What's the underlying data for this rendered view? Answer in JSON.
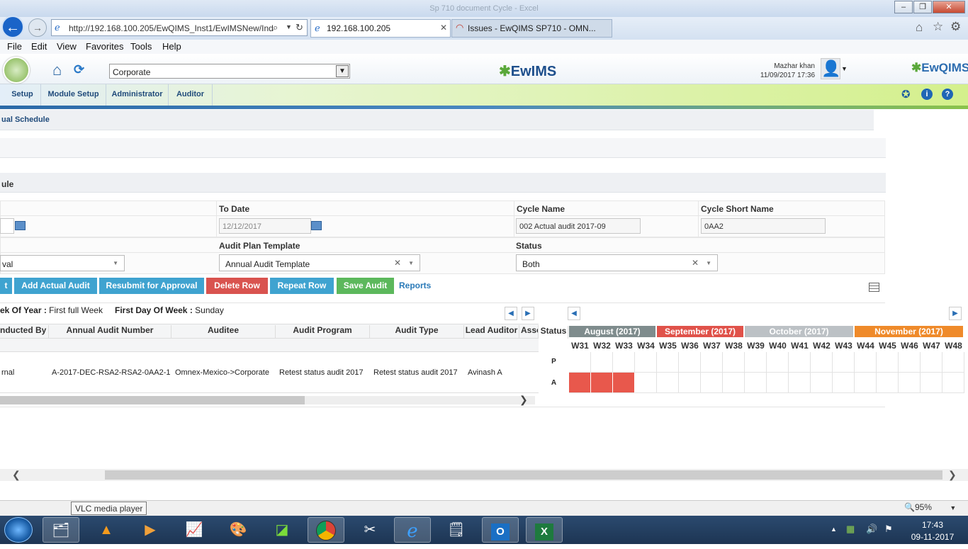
{
  "window": {
    "title": "Sp 710 document Cycle - Excel"
  },
  "browser": {
    "address": "http://192.168.100.205/EwQIMS_Inst1/EwIMSNew/Ind",
    "tabs": [
      {
        "label": "192.168.100.205"
      },
      {
        "label": "Issues - EwQIMS SP710 - OMN..."
      }
    ]
  },
  "menu": [
    "File",
    "Edit",
    "View",
    "Favorites",
    "Tools",
    "Help"
  ],
  "header": {
    "org": "Corporate",
    "logo": "EwIMS",
    "logo_right": "EwQIMS",
    "user_name": "Mazhar khan",
    "user_time": "11/09/2017 17:36"
  },
  "nav": [
    "Setup",
    "Module Setup",
    "Administrator",
    "Auditor"
  ],
  "page": {
    "breadcrumb": "ual Schedule",
    "section_title": "ule",
    "to_date_label": "To Date",
    "to_date_value": "12/12/2017",
    "cycle_name_label": "Cycle Name",
    "cycle_name_value": "002 Actual audit 2017-09",
    "cycle_short_label": "Cycle Short Name",
    "cycle_short_value": "0AA2",
    "left_select_value": "val",
    "template_label": "Audit Plan Template",
    "template_value": "Annual Audit Template",
    "status_label": "Status",
    "status_value": "Both",
    "buttons": {
      "partial": "t",
      "add": "Add Actual Audit",
      "resubmit": "Resubmit for Approval",
      "delete": "Delete Row",
      "repeat": "Repeat Row",
      "save": "Save Audit",
      "reports": "Reports"
    },
    "week_of_year_label": "ek Of Year :",
    "week_of_year_value": "First full Week",
    "first_day_label": "First Day Of Week :",
    "first_day_value": "Sunday",
    "columns": [
      "nducted By",
      "Annual Audit Number",
      "Auditee",
      "Audit Program",
      "Audit Type",
      "Lead Auditor",
      "Asso",
      "Status"
    ],
    "row": [
      "rnal",
      "A-2017-DEC-RSA2-RSA2-0AA2-1",
      "Omnex-Mexico->Corporate",
      "Retest status audit 2017",
      "Retest status audit 2017",
      "Avinash A"
    ],
    "gantt": {
      "months": [
        {
          "label": "August (2017)",
          "color": "#7f8c8d"
        },
        {
          "label": "September (2017)",
          "color": "#e0524a"
        },
        {
          "label": "October (2017)",
          "color": "#bcc1c5"
        },
        {
          "label": "November (2017)",
          "color": "#ef8a2a"
        }
      ],
      "weeks": [
        "W31",
        "W32",
        "W33",
        "W34",
        "W35",
        "W36",
        "W37",
        "W38",
        "W39",
        "W40",
        "W41",
        "W42",
        "W43",
        "W44",
        "W45",
        "W46",
        "W47",
        "W48"
      ],
      "row_labels": [
        "P",
        "A"
      ],
      "actual_fill_color": "#e8584c"
    }
  },
  "statusbar": {
    "tooltip": "VLC media player",
    "zoom": "95%"
  },
  "taskbar": {
    "time": "17:43",
    "date": "09-11-2017"
  }
}
